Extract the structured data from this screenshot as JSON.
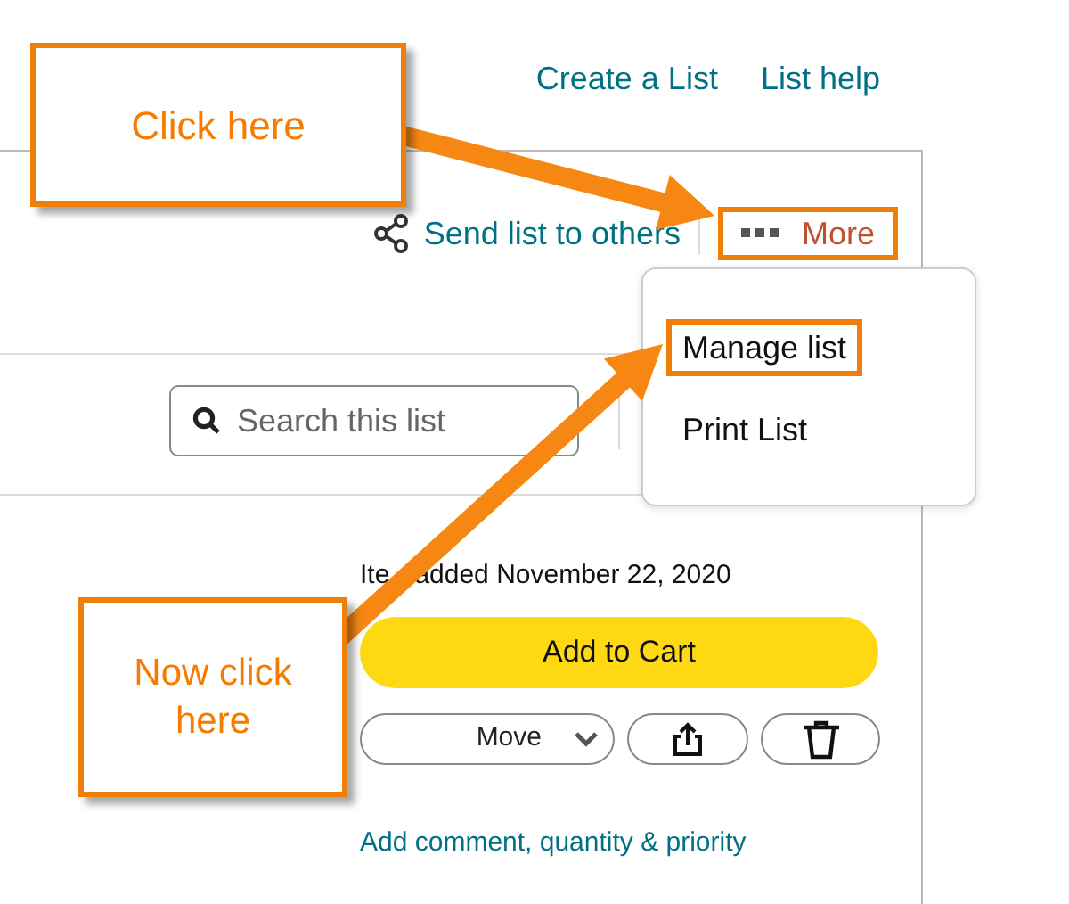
{
  "header_links": [
    {
      "label": "Create a List"
    },
    {
      "label": "List help"
    }
  ],
  "list_actions": {
    "share": "Send list to others",
    "more": "More",
    "more_highlighted": true
  },
  "more_menu": {
    "items": [
      {
        "label": "Manage list",
        "highlighted": true
      },
      {
        "label": "Print List",
        "highlighted": false
      }
    ]
  },
  "search": {
    "placeholder": "Search this list"
  },
  "item": {
    "added_visible_start": "Ite",
    "added_visible_rest": "added November 22, 2020",
    "add_to_cart": "Add to Cart",
    "move": "Move",
    "comment_link": "Add comment, quantity & priority"
  },
  "callouts": [
    {
      "text": "Click here"
    },
    {
      "text": "Now click here"
    }
  ]
}
